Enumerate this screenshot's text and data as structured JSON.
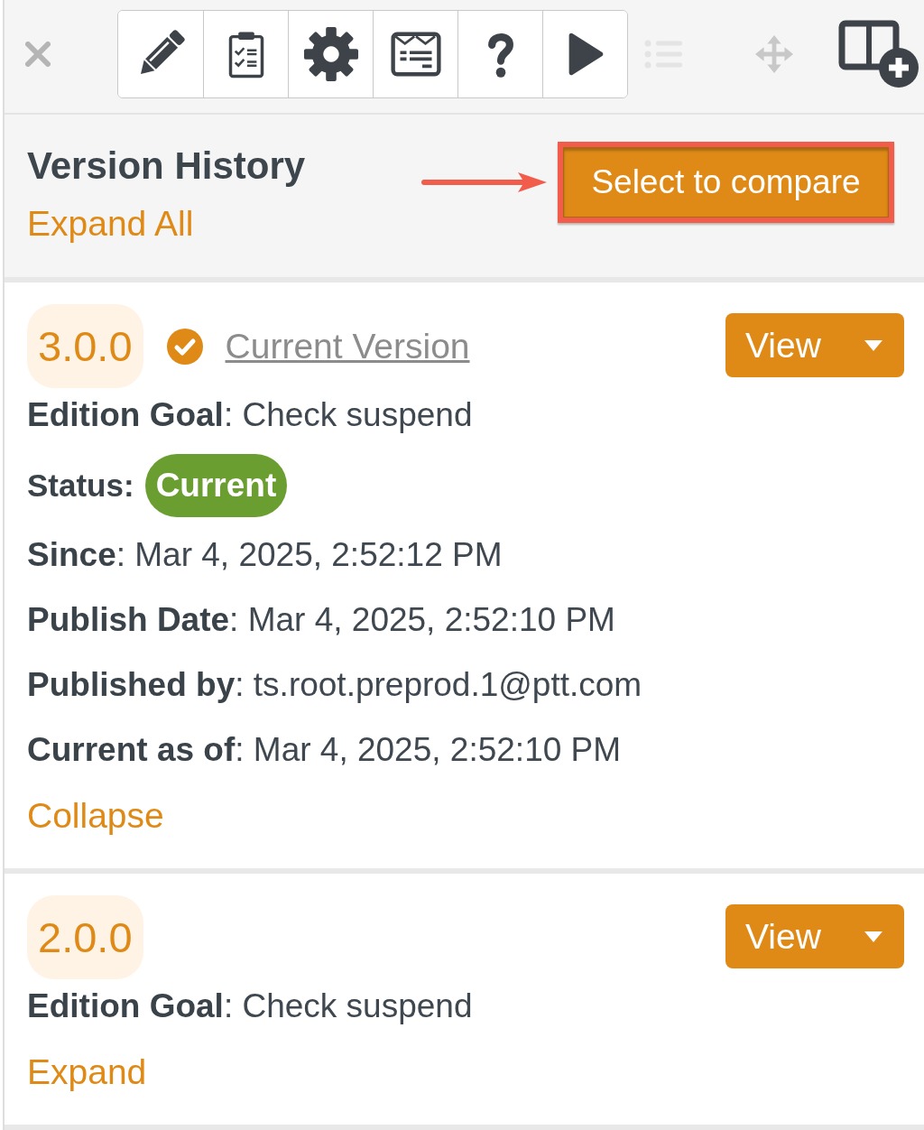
{
  "toolbar": {
    "tools": [
      {
        "kind": "pencil"
      },
      {
        "kind": "clipboard"
      },
      {
        "kind": "gear"
      },
      {
        "kind": "form"
      },
      {
        "kind": "help"
      },
      {
        "kind": "play"
      }
    ],
    "extras": [
      {
        "kind": "list",
        "disabled": true
      },
      {
        "kind": "move",
        "disabled": true
      },
      {
        "kind": "add-column",
        "disabled": false
      }
    ]
  },
  "header": {
    "title": "Version History",
    "expand_all": "Expand All",
    "compare_button": {
      "label": "Select to compare",
      "highlighted": true
    }
  },
  "versions": [
    {
      "version": "3.0.0",
      "current": true,
      "current_link": "Current Version",
      "view_button": "View",
      "fields": [
        {
          "kind": "text",
          "text": "**Edition Goal**: Check suspend"
        },
        {
          "kind": "status",
          "label": "Status:",
          "badge": "Current"
        },
        {
          "kind": "text",
          "text": "**Since**: Mar 4, 2025, 2:52:12 PM"
        },
        {
          "kind": "text",
          "text": "**Publish Date**: Mar 4, 2025, 2:52:10 PM"
        },
        {
          "kind": "text",
          "text": "**Published by**: ts.root.preprod.1@ptt.com"
        },
        {
          "kind": "text",
          "text": "**Current as of**: Mar 4, 2025, 2:52:10 PM"
        }
      ],
      "toggle": "Collapse"
    },
    {
      "version": "2.0.0",
      "current": false,
      "view_button": "View",
      "fields": [
        {
          "kind": "text",
          "text": "**Edition Goal**: Check suspend"
        }
      ],
      "toggle": "Expand"
    }
  ]
}
